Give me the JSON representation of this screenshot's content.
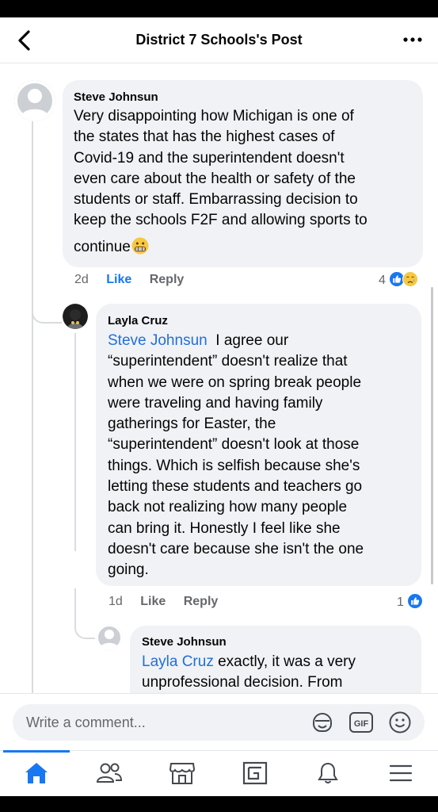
{
  "header": {
    "title": "District 7 Schools's Post"
  },
  "comments": [
    {
      "author": "Steve Johnsun",
      "lines": [
        "Very disappointing how Michigan is one of",
        "the states that has the highest cases of",
        "Covid-19 and the superintendent doesn't",
        "even care about the health or safety of the",
        "students or staff.  Embarrassing decision to",
        "keep the schools F2F and allowing sports to",
        "continue"
      ],
      "emoji": "😬",
      "time": "2d",
      "like": "Like",
      "reply": "Reply",
      "reaction_count": "4"
    },
    {
      "author": "Layla Cruz",
      "mention": "Steve Johnsun",
      "first_line_rest": "I agree our",
      "lines": [
        "“superintendent” doesn't realize that",
        "when we were on spring break people",
        "were traveling and having family",
        "gatherings for Easter, the",
        "“superintendent” doesn't look at those",
        "things. Which is selfish because she's",
        "letting these students and teachers  go",
        "back not realizing how many people",
        "can bring it. Honestly I feel like she",
        "doesn't care because she isn't the one",
        "going."
      ],
      "time": "1d",
      "like": "Like",
      "reply": "Reply",
      "reaction_count": "1"
    },
    {
      "author": "Steve Johnsun",
      "mention": "Layla Cruz",
      "first_line_rest": "exactly, it was a very",
      "lines": [
        "unprofessional decision.  From"
      ]
    }
  ],
  "composer": {
    "placeholder": "Write a comment..."
  },
  "icons": {
    "header": [
      "back-arrow-icon",
      "more-options-icon"
    ],
    "composer": [
      "sticker-icon",
      "gif-icon",
      "emoji-icon"
    ],
    "tabs": [
      "home-icon",
      "friends-icon",
      "marketplace-icon",
      "groups-icon",
      "notifications-icon",
      "menu-icon"
    ],
    "reactions": [
      "like-reaction-icon",
      "sad-reaction-icon"
    ]
  },
  "colors": {
    "accent": "#1877f2",
    "mention": "#216fdb",
    "bubble": "#f0f2f5",
    "muted": "#65676b"
  }
}
